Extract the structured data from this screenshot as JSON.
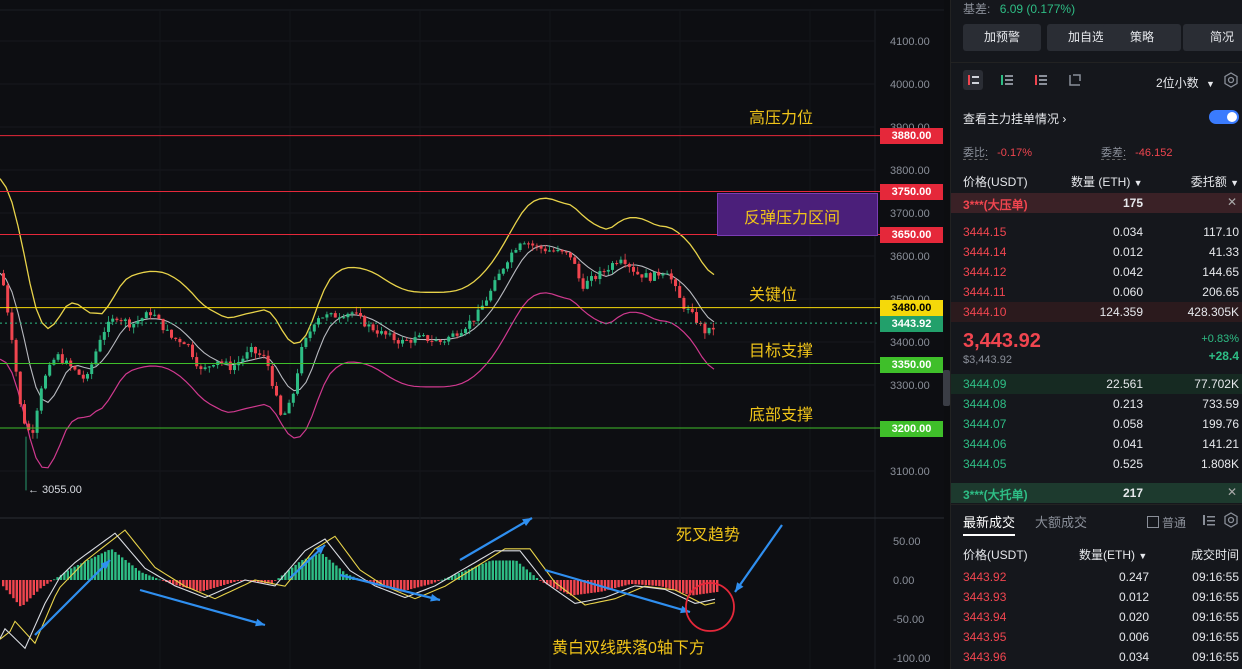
{
  "y_axis_labels": [
    "4100.00",
    "4000.00",
    "3900.00",
    "3800.00",
    "3700.00",
    "3600.00",
    "3500.00",
    "3400.00",
    "3300.00",
    "3200.00",
    "3100.00"
  ],
  "macd_axis_labels": [
    "50.00",
    "0.00",
    "-50.00",
    "-100.00"
  ],
  "price_tags": {
    "t3880": "3880.00",
    "t3750": "3750.00",
    "t3650": "3650.00",
    "t3480": "3480.00",
    "t3443": "3443.92",
    "t3350": "3350.00",
    "t3200": "3200.00"
  },
  "low_marker": "← 3055.00",
  "annotations": {
    "high_pressure": "高压力位",
    "rebound_zone": "反弹压力区间",
    "key_level": "关键位",
    "target_support": "目标支撑",
    "bottom_support": "底部支撑",
    "death_cross": "死叉趋势",
    "lines_below_zero": "黄白双线跌落0轴下方"
  },
  "colors": {
    "up": "#2ebd85",
    "down": "#f0454f",
    "accent": "#3a7bfd",
    "gold": "#f0c419",
    "purple": "#4b1f7a"
  },
  "sidebar": {
    "basis_label": "基差:",
    "basis_value": "6.09 (0.177%)",
    "buttons": [
      "加预警",
      "加自选",
      "策略",
      "简况"
    ],
    "decimals": "2位小数",
    "main_orders": "查看主力挂单情况",
    "ratio_label": "委比:",
    "ratio_value": "-0.17%",
    "diff_label": "委差:",
    "diff_value": "-46.152",
    "col_price": "价格(USDT)",
    "col_qty": "数量 (ETH)",
    "col_amount": "委托额",
    "big_ask_label": "3***(大压单)",
    "big_ask_qty": "175",
    "asks": [
      {
        "price": "3444.15",
        "qty": "0.034",
        "amount": "117.10"
      },
      {
        "price": "3444.14",
        "qty": "0.012",
        "amount": "41.33"
      },
      {
        "price": "3444.12",
        "qty": "0.042",
        "amount": "144.65"
      },
      {
        "price": "3444.11",
        "qty": "0.060",
        "amount": "206.65"
      },
      {
        "price": "3444.10",
        "qty": "124.359",
        "amount": "428.305K"
      }
    ],
    "last_price": "3,443.92",
    "last_price_usd": "$3,443.92",
    "change_pct": "+0.83%",
    "change_abs": "+28.4",
    "bids": [
      {
        "price": "3444.09",
        "qty": "22.561",
        "amount": "77.702K"
      },
      {
        "price": "3444.08",
        "qty": "0.213",
        "amount": "733.59"
      },
      {
        "price": "3444.07",
        "qty": "0.058",
        "amount": "199.76"
      },
      {
        "price": "3444.06",
        "qty": "0.041",
        "amount": "141.21"
      },
      {
        "price": "3444.05",
        "qty": "0.525",
        "amount": "1.808K"
      }
    ],
    "big_bid_label": "3***(大托单)",
    "big_bid_qty": "217",
    "tab_latest": "最新成交",
    "tab_large": "大额成交",
    "normal_label": "普通",
    "trade_col_price": "价格(USDT)",
    "trade_col_qty": "数量(ETH)",
    "trade_col_time": "成交时间",
    "trades": [
      {
        "price": "3443.92",
        "qty": "0.247",
        "time": "09:16:55"
      },
      {
        "price": "3443.93",
        "qty": "0.012",
        "time": "09:16:55"
      },
      {
        "price": "3443.94",
        "qty": "0.020",
        "time": "09:16:55"
      },
      {
        "price": "3443.95",
        "qty": "0.006",
        "time": "09:16:55"
      },
      {
        "price": "3443.96",
        "qty": "0.034",
        "time": "09:16:55"
      }
    ]
  }
}
